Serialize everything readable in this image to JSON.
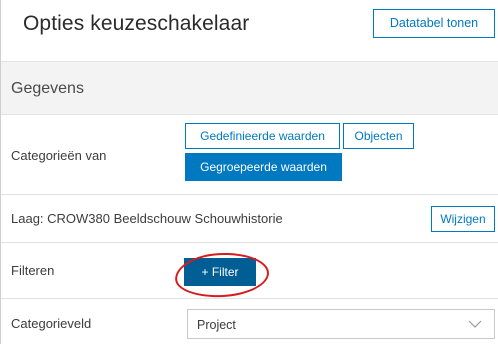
{
  "header": {
    "title": "Opties keuzeschakelaar",
    "datatable_button": "Datatabel tonen"
  },
  "section": {
    "title": "Gegevens"
  },
  "categories": {
    "label": "Categorieën van",
    "defined_values": "Gedefinieerde waarden",
    "objects": "Objecten",
    "grouped_values": "Gegroepeerde waarden",
    "selected": "Gegroepeerde waarden"
  },
  "layer": {
    "label": "Laag: CROW380 Beeldschouw Schouwhistorie",
    "change_button": "Wijzigen"
  },
  "filter": {
    "label": "Filteren",
    "button": "+ Filter"
  },
  "category_field": {
    "label": "Categorieveld",
    "value": "Project"
  },
  "colors": {
    "accent": "#0079c1",
    "annotation": "#d61c1c"
  }
}
